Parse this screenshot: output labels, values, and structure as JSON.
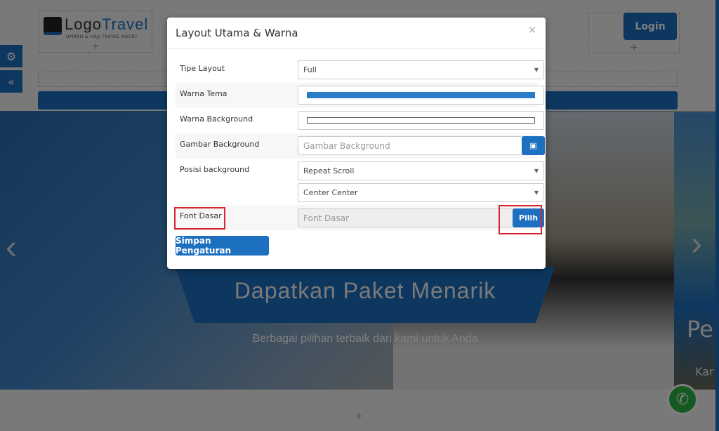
{
  "page": {
    "logo": {
      "main_a": "Logo",
      "main_b": "Travel",
      "subtitle": "UMRAH & HAJJ TRAVEL AGENT"
    },
    "login_label": "Login",
    "hero": {
      "title": "Dapatkan Paket Menarik",
      "subtitle": "Berbagai pilihan terbaik dari kami untuk Anda",
      "next_slide_title": "Pe",
      "next_slide_sub": "Kar"
    },
    "icons": {
      "settings": "gears-icon",
      "collapse": "double-chevron-left-icon",
      "whatsapp": "whatsapp-icon"
    }
  },
  "modal": {
    "title": "Layout Utama & Warna",
    "close": "×",
    "fields": [
      {
        "label": "Tipe Layout",
        "value": "Full"
      },
      {
        "label": "Warna Tema",
        "color": "#2a7cc7"
      },
      {
        "label": "Warna Background",
        "color": "#ffffff"
      },
      {
        "label": "Gambar Background",
        "placeholder": "Gambar Background"
      },
      {
        "label": "Posisi background",
        "value": "Repeat Scroll",
        "value2": "Center Center"
      },
      {
        "label": "Font Dasar",
        "placeholder": "Font Dasar",
        "button": "Pilih"
      }
    ],
    "save_label": "Simpan Pengaturan"
  },
  "colors": {
    "accent": "#1d6fc0",
    "highlight": "#d9232d"
  }
}
